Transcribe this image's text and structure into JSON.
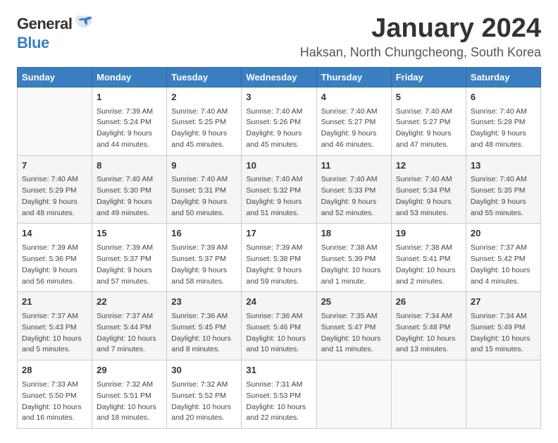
{
  "logo": {
    "general": "General",
    "blue": "Blue"
  },
  "title": {
    "month": "January 2024",
    "location": "Haksan, North Chungcheong, South Korea"
  },
  "weekdays": [
    "Sunday",
    "Monday",
    "Tuesday",
    "Wednesday",
    "Thursday",
    "Friday",
    "Saturday"
  ],
  "weeks": [
    [
      {
        "day": "",
        "info": ""
      },
      {
        "day": "1",
        "info": "Sunrise: 7:39 AM\nSunset: 5:24 PM\nDaylight: 9 hours\nand 44 minutes."
      },
      {
        "day": "2",
        "info": "Sunrise: 7:40 AM\nSunset: 5:25 PM\nDaylight: 9 hours\nand 45 minutes."
      },
      {
        "day": "3",
        "info": "Sunrise: 7:40 AM\nSunset: 5:26 PM\nDaylight: 9 hours\nand 45 minutes."
      },
      {
        "day": "4",
        "info": "Sunrise: 7:40 AM\nSunset: 5:27 PM\nDaylight: 9 hours\nand 46 minutes."
      },
      {
        "day": "5",
        "info": "Sunrise: 7:40 AM\nSunset: 5:27 PM\nDaylight: 9 hours\nand 47 minutes."
      },
      {
        "day": "6",
        "info": "Sunrise: 7:40 AM\nSunset: 5:28 PM\nDaylight: 9 hours\nand 48 minutes."
      }
    ],
    [
      {
        "day": "7",
        "info": "Sunrise: 7:40 AM\nSunset: 5:29 PM\nDaylight: 9 hours\nand 48 minutes."
      },
      {
        "day": "8",
        "info": "Sunrise: 7:40 AM\nSunset: 5:30 PM\nDaylight: 9 hours\nand 49 minutes."
      },
      {
        "day": "9",
        "info": "Sunrise: 7:40 AM\nSunset: 5:31 PM\nDaylight: 9 hours\nand 50 minutes."
      },
      {
        "day": "10",
        "info": "Sunrise: 7:40 AM\nSunset: 5:32 PM\nDaylight: 9 hours\nand 51 minutes."
      },
      {
        "day": "11",
        "info": "Sunrise: 7:40 AM\nSunset: 5:33 PM\nDaylight: 9 hours\nand 52 minutes."
      },
      {
        "day": "12",
        "info": "Sunrise: 7:40 AM\nSunset: 5:34 PM\nDaylight: 9 hours\nand 53 minutes."
      },
      {
        "day": "13",
        "info": "Sunrise: 7:40 AM\nSunset: 5:35 PM\nDaylight: 9 hours\nand 55 minutes."
      }
    ],
    [
      {
        "day": "14",
        "info": "Sunrise: 7:39 AM\nSunset: 5:36 PM\nDaylight: 9 hours\nand 56 minutes."
      },
      {
        "day": "15",
        "info": "Sunrise: 7:39 AM\nSunset: 5:37 PM\nDaylight: 9 hours\nand 57 minutes."
      },
      {
        "day": "16",
        "info": "Sunrise: 7:39 AM\nSunset: 5:37 PM\nDaylight: 9 hours\nand 58 minutes."
      },
      {
        "day": "17",
        "info": "Sunrise: 7:39 AM\nSunset: 5:38 PM\nDaylight: 9 hours\nand 59 minutes."
      },
      {
        "day": "18",
        "info": "Sunrise: 7:38 AM\nSunset: 5:39 PM\nDaylight: 10 hours\nand 1 minute."
      },
      {
        "day": "19",
        "info": "Sunrise: 7:38 AM\nSunset: 5:41 PM\nDaylight: 10 hours\nand 2 minutes."
      },
      {
        "day": "20",
        "info": "Sunrise: 7:37 AM\nSunset: 5:42 PM\nDaylight: 10 hours\nand 4 minutes."
      }
    ],
    [
      {
        "day": "21",
        "info": "Sunrise: 7:37 AM\nSunset: 5:43 PM\nDaylight: 10 hours\nand 5 minutes."
      },
      {
        "day": "22",
        "info": "Sunrise: 7:37 AM\nSunset: 5:44 PM\nDaylight: 10 hours\nand 7 minutes."
      },
      {
        "day": "23",
        "info": "Sunrise: 7:36 AM\nSunset: 5:45 PM\nDaylight: 10 hours\nand 8 minutes."
      },
      {
        "day": "24",
        "info": "Sunrise: 7:36 AM\nSunset: 5:46 PM\nDaylight: 10 hours\nand 10 minutes."
      },
      {
        "day": "25",
        "info": "Sunrise: 7:35 AM\nSunset: 5:47 PM\nDaylight: 10 hours\nand 11 minutes."
      },
      {
        "day": "26",
        "info": "Sunrise: 7:34 AM\nSunset: 5:48 PM\nDaylight: 10 hours\nand 13 minutes."
      },
      {
        "day": "27",
        "info": "Sunrise: 7:34 AM\nSunset: 5:49 PM\nDaylight: 10 hours\nand 15 minutes."
      }
    ],
    [
      {
        "day": "28",
        "info": "Sunrise: 7:33 AM\nSunset: 5:50 PM\nDaylight: 10 hours\nand 16 minutes."
      },
      {
        "day": "29",
        "info": "Sunrise: 7:32 AM\nSunset: 5:51 PM\nDaylight: 10 hours\nand 18 minutes."
      },
      {
        "day": "30",
        "info": "Sunrise: 7:32 AM\nSunset: 5:52 PM\nDaylight: 10 hours\nand 20 minutes."
      },
      {
        "day": "31",
        "info": "Sunrise: 7:31 AM\nSunset: 5:53 PM\nDaylight: 10 hours\nand 22 minutes."
      },
      {
        "day": "",
        "info": ""
      },
      {
        "day": "",
        "info": ""
      },
      {
        "day": "",
        "info": ""
      }
    ]
  ]
}
